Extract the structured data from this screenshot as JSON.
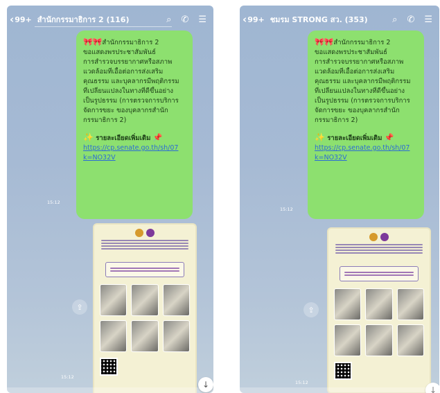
{
  "screens": [
    {
      "unread_count": "99+",
      "title": "สำนักกรรมาธิการ 2 (116)",
      "icons": [
        "search-icon",
        "phone-icon",
        "menu-icon"
      ],
      "message": {
        "lines": [
          "สำนักกรรมาธิการ 2",
          "ขอแสดงพรประชาสัมพันธ์",
          "การสำรวจบรรยากาศหรือสภาพ",
          "แวดล้อมที่เอื้อต่อการส่งเสริม",
          "คุณธรรม และบุคลากรมีพฤติกรรม",
          "ที่เปลี่ยนแปลงในทางที่ดีขึ้นอย่าง",
          "เป็นรูปธรรม (การตรวจการบริการ",
          "จัดการขยะ ของบุคลากรสำนัก",
          "กรรมาธิการ 2)"
        ],
        "detail_label": "รายละเอียดเพิ่มเติม",
        "link_lines": [
          "https://cp.senate.go.th/sh/07",
          "k=NO32V"
        ],
        "time": "15:12"
      },
      "poster_time": "15:12"
    },
    {
      "unread_count": "99+",
      "title": "ชมรม STRONG สว. (353)",
      "icons": [
        "search-icon",
        "phone-icon",
        "menu-icon"
      ],
      "message": {
        "lines": [
          "สำนักกรรมาธิการ 2",
          "ขอแสดงพรประชาสัมพันธ์",
          "การสำรวจบรรยากาศหรือสภาพ",
          "แวดล้อมที่เอื้อต่อการส่งเสริม",
          "คุณธรรม และบุคลากรมีพฤติกรรม",
          "ที่เปลี่ยนแปลงในทางที่ดีขึ้นอย่าง",
          "เป็นรูปธรรม (การตรวจการบริการ",
          "จัดการขยะ ของบุคลากรสำนัก",
          "กรรมาธิการ 2)"
        ],
        "detail_label": "รายละเอียดเพิ่มเติม",
        "link_lines": [
          "https://cp.senate.go.th/sh/07",
          "k=NO32V"
        ],
        "time": "15:12"
      },
      "poster_time": "15:12"
    }
  ],
  "colors": {
    "chat_background": "#a6bad4",
    "bubble": "#8de06f",
    "link": "#2c6bd6",
    "ribbon": "#d1243b",
    "poster": "#f4f1d4"
  }
}
